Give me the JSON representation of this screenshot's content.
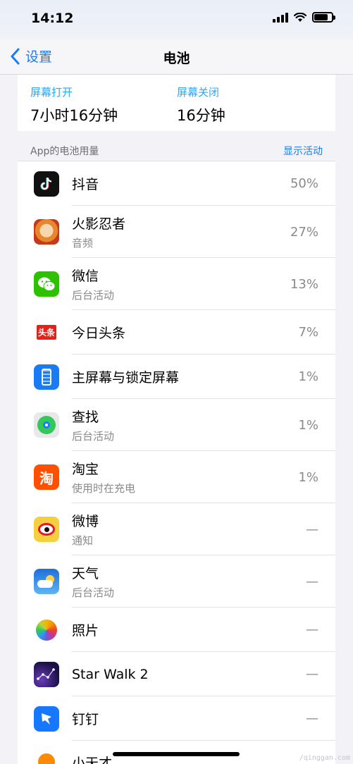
{
  "status": {
    "time": "14:12"
  },
  "nav": {
    "back_label": "设置",
    "title": "电池"
  },
  "screen": {
    "on_label": "屏幕打开",
    "on_value": "7小时16分钟",
    "off_label": "屏幕关闭",
    "off_value": "16分钟"
  },
  "section": {
    "title": "App的电池用量",
    "link": "显示活动"
  },
  "apps": [
    {
      "name": "抖音",
      "sub": "",
      "pct": "50%",
      "icon": "douyin-icon"
    },
    {
      "name": "火影忍者",
      "sub": "音频",
      "pct": "27%",
      "icon": "naruto-icon"
    },
    {
      "name": "微信",
      "sub": "后台活动",
      "pct": "13%",
      "icon": "wechat-icon"
    },
    {
      "name": "今日头条",
      "sub": "",
      "pct": "7%",
      "icon": "toutiao-icon"
    },
    {
      "name": "主屏幕与锁定屏幕",
      "sub": "",
      "pct": "1%",
      "icon": "homescreen-icon"
    },
    {
      "name": "查找",
      "sub": "后台活动",
      "pct": "1%",
      "icon": "findmy-icon"
    },
    {
      "name": "淘宝",
      "sub": "使用时在充电",
      "pct": "1%",
      "icon": "taobao-icon"
    },
    {
      "name": "微博",
      "sub": "通知",
      "pct": "—",
      "icon": "weibo-icon"
    },
    {
      "name": "天气",
      "sub": "后台活动",
      "pct": "—",
      "icon": "weather-icon"
    },
    {
      "name": "照片",
      "sub": "",
      "pct": "—",
      "icon": "photos-icon"
    },
    {
      "name": "Star Walk 2",
      "sub": "",
      "pct": "—",
      "icon": "starwalk-icon"
    },
    {
      "name": "钉钉",
      "sub": "",
      "pct": "—",
      "icon": "dingtalk-icon"
    },
    {
      "name": "小天才",
      "sub": "",
      "pct": "",
      "icon": "xiaotiancai-icon"
    }
  ],
  "watermark": "/qinggan.com"
}
